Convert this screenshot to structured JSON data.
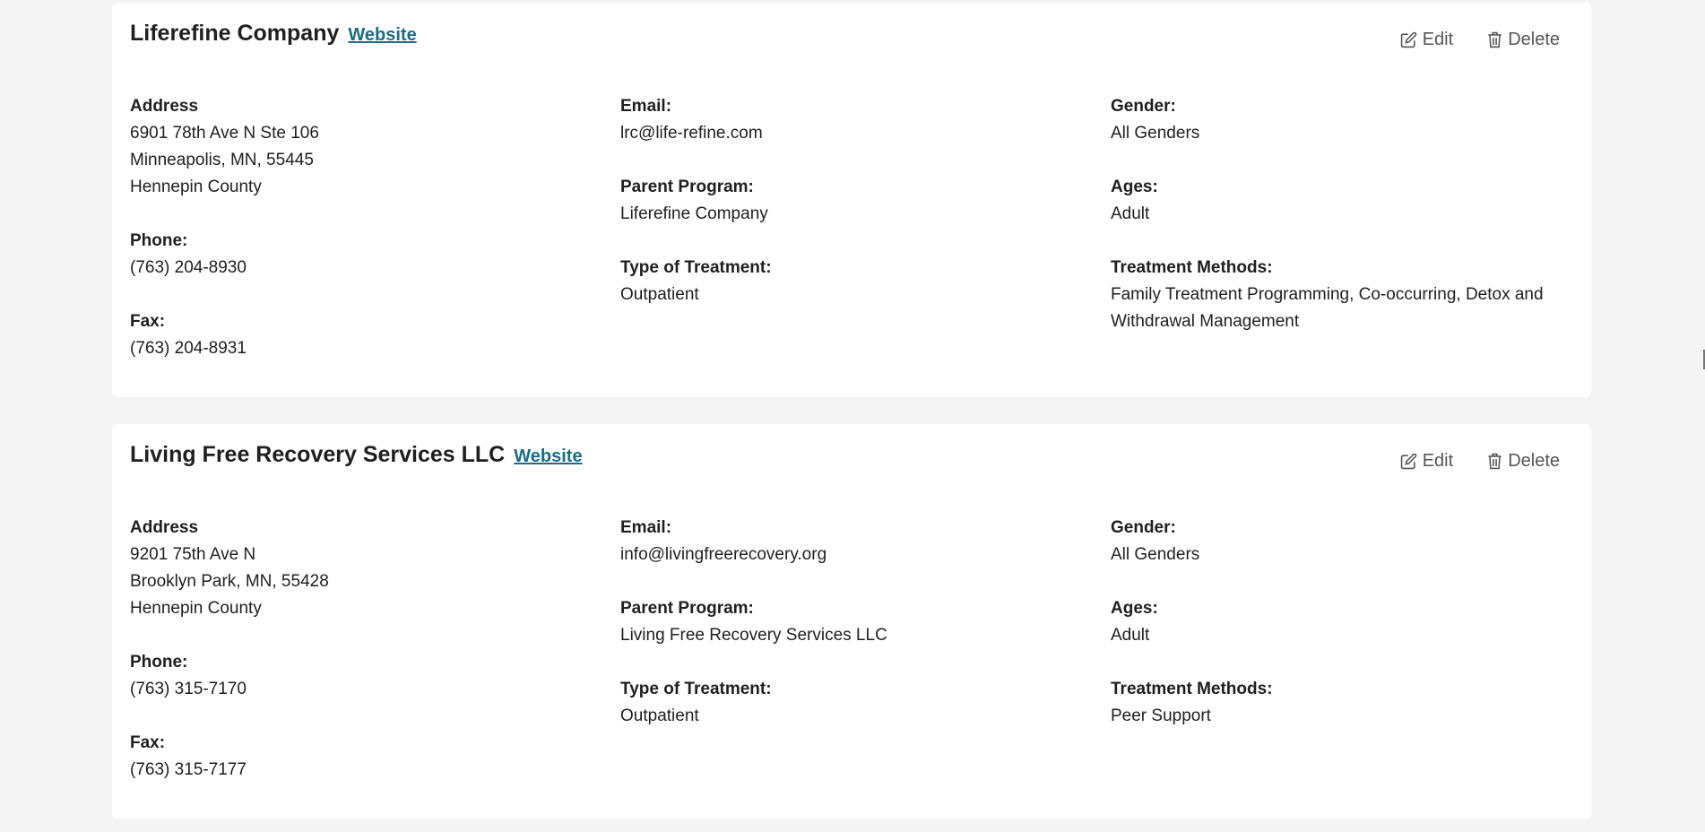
{
  "cards": [
    {
      "name": "Liferefine Company",
      "website_label": "Website",
      "edit_label": "Edit",
      "delete_label": "Delete",
      "address_label": "Address",
      "address_line1": "6901 78th Ave N Ste 106",
      "address_line2": "Minneapolis, MN, 55445",
      "county": "Hennepin County",
      "phone_label": "Phone:",
      "phone": "(763) 204-8930",
      "fax_label": "Fax:",
      "fax": "(763) 204-8931",
      "email_label": "Email:",
      "email": "lrc@life-refine.com",
      "parent_label": "Parent Program:",
      "parent": "Liferefine Company",
      "treatment_type_label": "Type of Treatment:",
      "treatment_type": "Outpatient",
      "gender_label": "Gender:",
      "gender": "All Genders",
      "ages_label": "Ages:",
      "ages": "Adult",
      "methods_label": "Treatment Methods:",
      "methods": "Family Treatment Programming, Co-occurring, Detox and Withdrawal Management"
    },
    {
      "name": "Living Free Recovery Services LLC",
      "website_label": "Website",
      "edit_label": "Edit",
      "delete_label": "Delete",
      "address_label": "Address",
      "address_line1": "9201 75th Ave N",
      "address_line2": "Brooklyn Park, MN, 55428",
      "county": "Hennepin County",
      "phone_label": "Phone:",
      "phone": "(763) 315-7170",
      "fax_label": "Fax:",
      "fax": "(763) 315-7177",
      "email_label": "Email:",
      "email": "info@livingfreerecovery.org",
      "parent_label": "Parent Program:",
      "parent": "Living Free Recovery Services LLC",
      "treatment_type_label": "Type of Treatment:",
      "treatment_type": "Outpatient",
      "gender_label": "Gender:",
      "gender": "All Genders",
      "ages_label": "Ages:",
      "ages": "Adult",
      "methods_label": "Treatment Methods:",
      "methods": "Peer Support"
    }
  ],
  "icons": {
    "edit": "edit-icon",
    "delete": "trash-icon"
  },
  "colors": {
    "background": "#f4f4f4",
    "card": "#ffffff",
    "link": "#1b6d86",
    "action": "#555555"
  }
}
